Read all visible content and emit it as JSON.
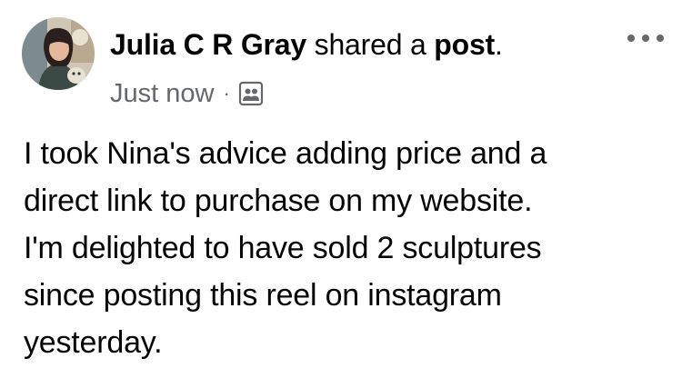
{
  "post": {
    "author_name": "Julia C R Gray",
    "action_text": "shared a",
    "object_text": "post",
    "object_suffix": ".",
    "timestamp": "Just now",
    "separator": "·",
    "audience_icon": "friends-icon",
    "more_icon": "more-options-icon",
    "body_lines": [
      "I took Nina's advice adding price and a",
      "direct link to purchase on my website.",
      "I'm delighted to have sold 2 sculptures",
      "since posting this reel on instagram",
      "yesterday."
    ]
  },
  "colors": {
    "primary_text": "#050505",
    "secondary_text": "#65676b",
    "background": "#ffffff"
  }
}
